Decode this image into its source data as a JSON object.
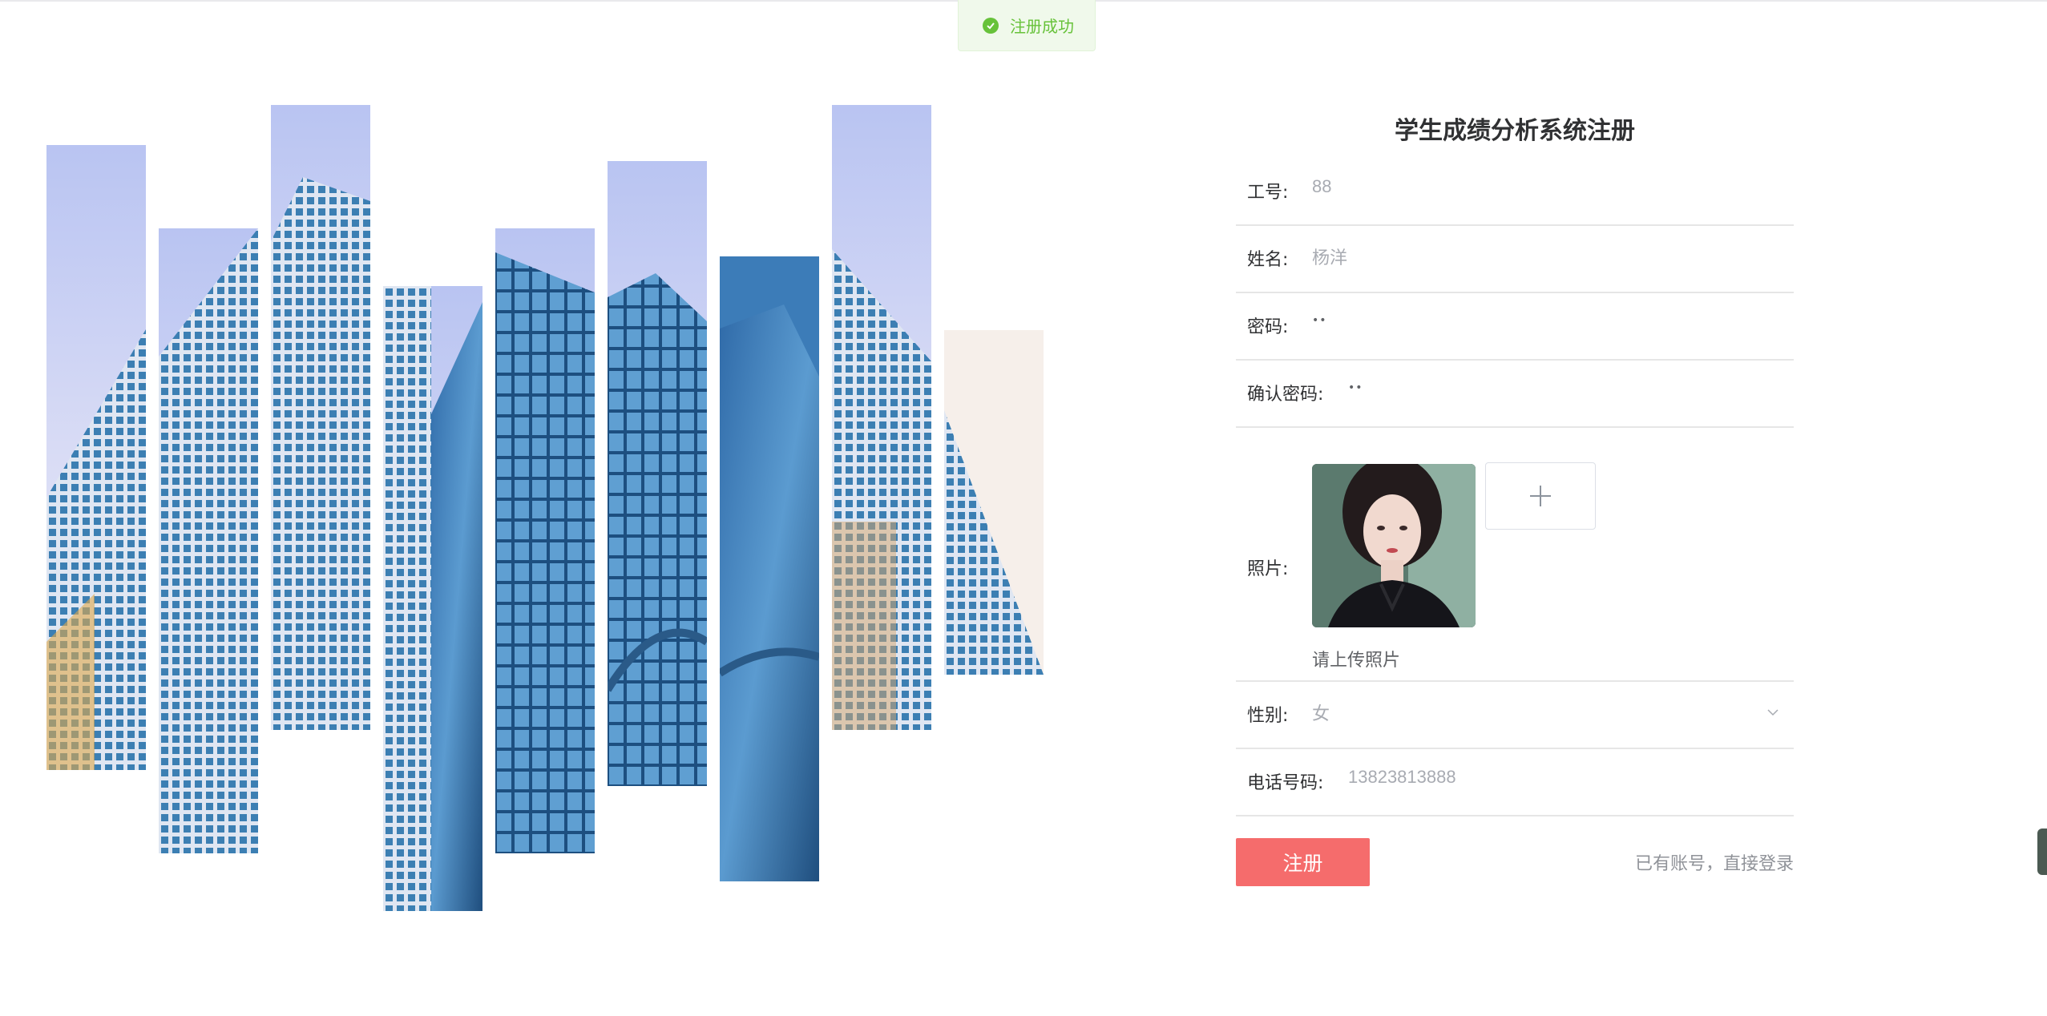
{
  "toast": {
    "message": "注册成功",
    "icon": "check-circle-icon",
    "color": "#67c23a"
  },
  "form": {
    "title": "学生成绩分析系统注册",
    "fields": {
      "work_id": {
        "label": "工号:",
        "value": "88"
      },
      "name": {
        "label": "姓名:",
        "value": "杨洋"
      },
      "password": {
        "label": "密码:",
        "value": "••"
      },
      "confirm_password": {
        "label": "确认密码:",
        "value": "••"
      },
      "photo": {
        "label": "照片:",
        "tip": "请上传照片",
        "upload_icon": "plus-icon"
      },
      "gender": {
        "label": "性别:",
        "value": "女",
        "icon": "chevron-down-icon"
      },
      "phone": {
        "label": "电话号码:",
        "value": "13823813888"
      }
    },
    "register_button": "注册",
    "login_link": "已有账号，直接登录"
  },
  "colors": {
    "accent": "#f56c6c",
    "success": "#67c23a"
  }
}
